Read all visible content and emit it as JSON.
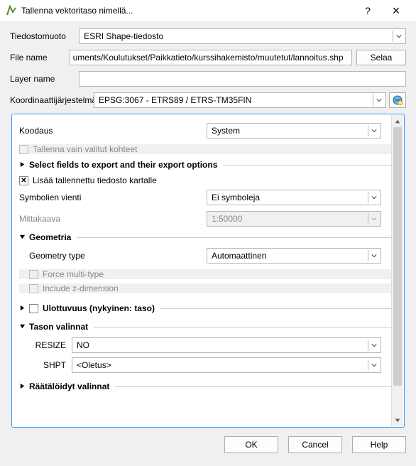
{
  "window": {
    "title": "Tallenna vektoritaso nimellä...",
    "help_btn": "?",
    "close_btn": "×"
  },
  "form": {
    "format_label": "Tiedostomuoto",
    "format_value": "ESRI Shape-tiedosto",
    "filename_label": "File name",
    "filename_value": "uments/Koulutukset/Paikkatieto/kurssihakemisto/muutetut/lannoitus.shp",
    "browse_btn": "Selaa",
    "layername_label": "Layer name",
    "layername_value": "",
    "crs_label": "Koordinaattijärjestelmä",
    "crs_value": "EPSG:3067 - ETRS89 / ETRS-TM35FIN"
  },
  "panel": {
    "encoding_label": "Koodaus",
    "encoding_value": "System",
    "save_selected_label": "Tallenna vain valitut kohteet",
    "select_fields_label": "Select fields to export and their export options",
    "add_saved_label": "Lisää tallennettu tiedosto kartalle",
    "symbology_label": "Symbolien vienti",
    "symbology_value": "Ei symboleja",
    "scale_label": "Mittakaava",
    "scale_value": "1:50000",
    "geometry": {
      "header": "Geometria",
      "type_label": "Geometry type",
      "type_value": "Automaattinen",
      "force_multi_label": "Force multi-type",
      "include_z_label": "Include z-dimension"
    },
    "extent_label": "Ulottuvuus (nykyinen: taso)",
    "layer_options": {
      "header": "Tason valinnat",
      "resize_label": "RESIZE",
      "resize_value": "NO",
      "shpt_label": "SHPT",
      "shpt_value": "<Oletus>"
    },
    "custom_options_label": "Räätälöidyt valinnat"
  },
  "footer": {
    "ok": "OK",
    "cancel": "Cancel",
    "help": "Help"
  }
}
